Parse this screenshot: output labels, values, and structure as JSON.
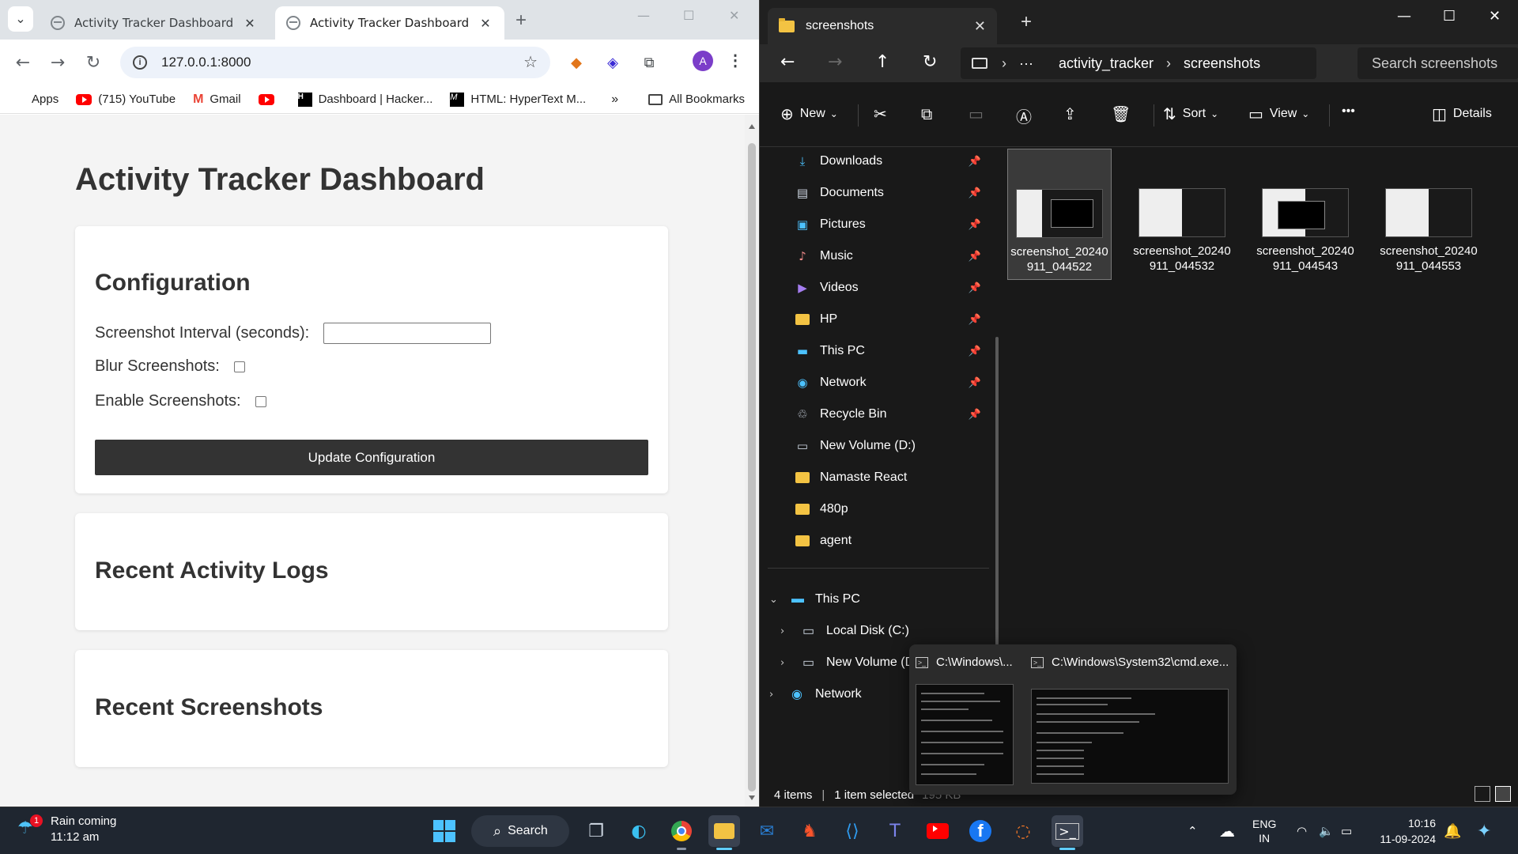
{
  "chrome": {
    "tabs": [
      {
        "title": "Activity Tracker Dashboard"
      },
      {
        "title": "Activity Tracker Dashboard"
      }
    ],
    "url": "127.0.0.1:8000",
    "avatar_letter": "A",
    "bookmarks": {
      "apps": "Apps",
      "youtube": "(715) YouTube",
      "gmail": "Gmail",
      "hackerrank": "Dashboard | Hacker...",
      "mdn": "HTML: HyperText M...",
      "more": "»",
      "all": "All Bookmarks"
    }
  },
  "dashboard": {
    "title": "Activity Tracker Dashboard",
    "config": {
      "heading": "Configuration",
      "interval_label": "Screenshot Interval (seconds):",
      "interval_value": "",
      "blur_label": "Blur Screenshots:",
      "blur_checked": false,
      "enable_label": "Enable Screenshots:",
      "enable_checked": false,
      "update_button": "Update Configuration"
    },
    "logs_heading": "Recent Activity Logs",
    "screens_heading": "Recent Screenshots"
  },
  "explorer": {
    "tab_title": "screenshots",
    "path": [
      "activity_tracker",
      "screenshots"
    ],
    "path_ellipsis": "···",
    "search_placeholder": "Search screenshots",
    "commands": {
      "new": "New",
      "sort": "Sort",
      "view": "View",
      "more": "•••",
      "details": "Details"
    },
    "quick_access": [
      {
        "label": "Downloads",
        "icon": "download-icon"
      },
      {
        "label": "Documents",
        "icon": "documents-icon"
      },
      {
        "label": "Pictures",
        "icon": "pictures-icon"
      },
      {
        "label": "Music",
        "icon": "music-icon"
      },
      {
        "label": "Videos",
        "icon": "videos-icon"
      },
      {
        "label": "HP",
        "icon": "folder-icon"
      },
      {
        "label": "This PC",
        "icon": "pc-icon"
      },
      {
        "label": "Network",
        "icon": "network-icon"
      },
      {
        "label": "Recycle Bin",
        "icon": "recycle-bin-icon"
      },
      {
        "label": "New Volume (D:)",
        "icon": "drive-icon"
      },
      {
        "label": "Namaste React",
        "icon": "folder-icon"
      },
      {
        "label": "480p",
        "icon": "folder-icon"
      },
      {
        "label": "agent",
        "icon": "folder-icon"
      }
    ],
    "tree": {
      "this_pc": "This PC",
      "local_disk": "Local Disk (C:)",
      "new_volume": "New Volume (D:)",
      "network": "Network"
    },
    "files": [
      {
        "name": "screenshot_20240911_044522",
        "selected": true
      },
      {
        "name": "screenshot_20240911_044532",
        "selected": false
      },
      {
        "name": "screenshot_20240911_044543",
        "selected": false
      },
      {
        "name": "screenshot_20240911_044553",
        "selected": false
      }
    ],
    "status": {
      "items": "4 items",
      "selected": "1 item selected",
      "size": "195 KB"
    }
  },
  "preview": {
    "window1": "C:\\Windows\\...",
    "window2": "C:\\Windows\\System32\\cmd.exe..."
  },
  "taskbar": {
    "weather_text": "Rain coming",
    "weather_time": "11:12 am",
    "weather_badge": "1",
    "search_label": "Search",
    "lang1": "ENG",
    "lang2": "IN",
    "time": "10:16",
    "date": "11-09-2024"
  },
  "colors": {
    "dashboard_button": "#333333",
    "explorer_bg": "#191919",
    "folder": "#f3c343",
    "taskbar": "#1f2630",
    "accent": "#60cdff"
  }
}
